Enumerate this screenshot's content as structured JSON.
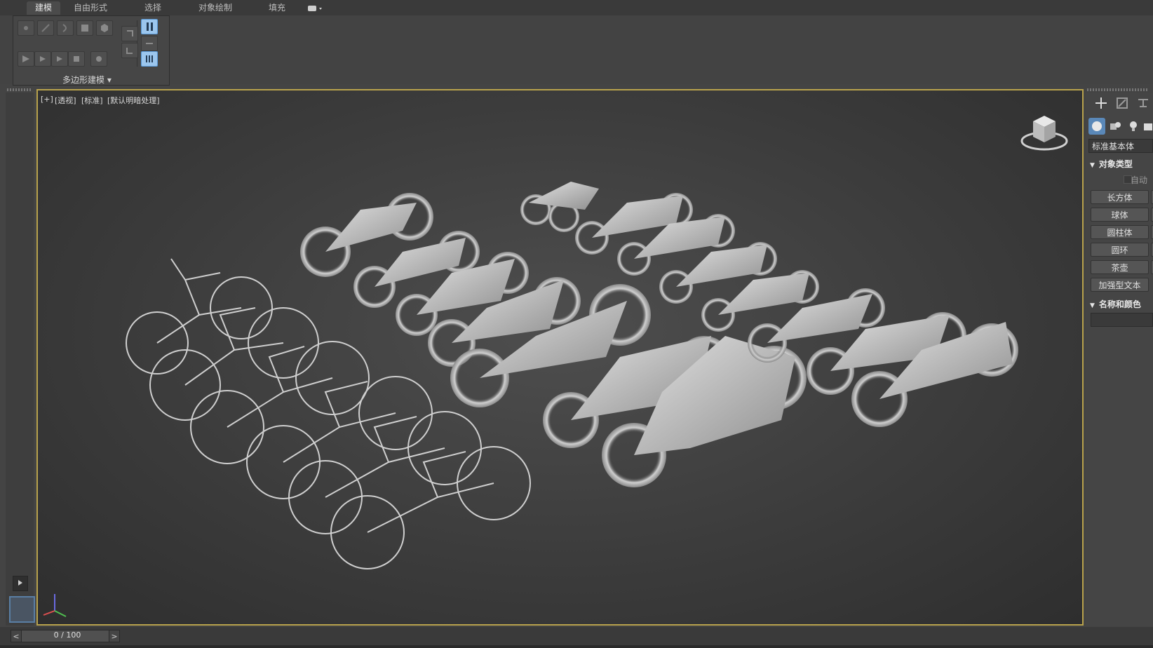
{
  "ribbon": {
    "tabs": [
      {
        "label": "建模",
        "active": true
      },
      {
        "label": "自由形式",
        "active": false
      },
      {
        "label": "选择",
        "active": false
      },
      {
        "label": "对象绘制",
        "active": false
      },
      {
        "label": "填充",
        "active": false
      }
    ],
    "panel_label": "多边形建模"
  },
  "viewport": {
    "labels": [
      "[+]",
      "[透视]",
      "[标准]",
      "[默认明暗处理]"
    ],
    "accent_color": "#b8a24c",
    "content": "perspective render of bicycles and motorcycles (grey clay shading)"
  },
  "command_panel": {
    "category_dropdown": "标准基本体",
    "rollout_object_type": "对象类型",
    "autogrid_label": "自动",
    "object_buttons": [
      "长方体",
      "球体",
      "圆柱体",
      "圆环",
      "茶壶",
      "加强型文本"
    ],
    "rollout_name_color": "名称和颜色",
    "selected_color": "#5a88b8"
  },
  "timeline": {
    "frame_text": "0 / 100",
    "prev": "<",
    "next": ">"
  }
}
